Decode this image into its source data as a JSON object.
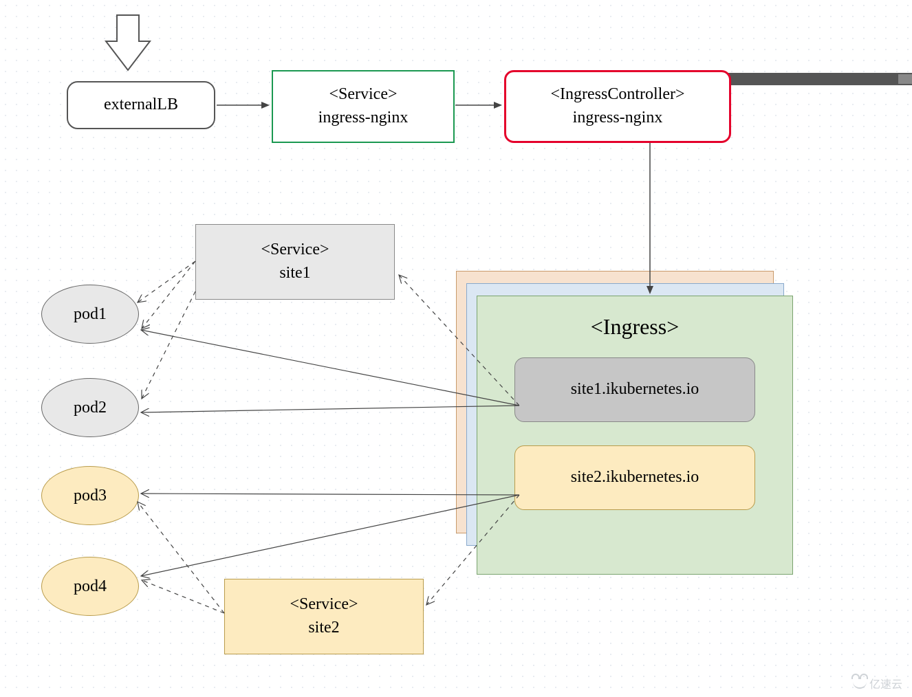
{
  "nodes": {
    "externalLB": {
      "label": "externalLB"
    },
    "serviceIngress": {
      "line1": "<Service>",
      "line2": "ingress-nginx"
    },
    "ingressController": {
      "line1": "<IngressController>",
      "line2": "ingress-nginx"
    },
    "serviceSite1": {
      "line1": "<Service>",
      "line2": "site1"
    },
    "serviceSite2": {
      "line1": "<Service>",
      "line2": "site2"
    },
    "ingressGroup": {
      "title": "<Ingress>",
      "rule1": "site1.ikubernetes.io",
      "rule2": "site2.ikubernetes.io"
    },
    "pod1": {
      "label": "pod1"
    },
    "pod2": {
      "label": "pod2"
    },
    "pod3": {
      "label": "pod3"
    },
    "pod4": {
      "label": "pod4"
    }
  },
  "watermark": "亿速云"
}
